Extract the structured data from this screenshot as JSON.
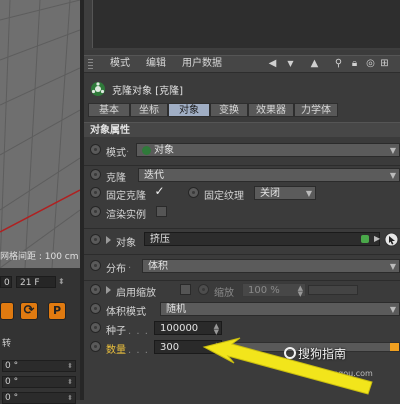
{
  "viewport": {
    "grid_spacing_text": "网格间距 : 100 cm"
  },
  "timeline": {
    "frame_start": "0",
    "frame_end": "21 F"
  },
  "left_panel": {
    "label": "转",
    "fields": [
      "0 °",
      "0 °",
      "0 °"
    ]
  },
  "attr_menu": {
    "items": [
      "模式",
      "编辑",
      "用户数据"
    ]
  },
  "object": {
    "title": "克隆对象 [克隆]"
  },
  "tabs": [
    {
      "label": "基本",
      "active": false
    },
    {
      "label": "坐标",
      "active": false
    },
    {
      "label": "对象",
      "active": true
    },
    {
      "label": "变换",
      "active": false
    },
    {
      "label": "效果器",
      "active": false
    },
    {
      "label": "力学体",
      "active": false
    }
  ],
  "section_title": "对象属性",
  "props": {
    "mode_label": "模式",
    "mode_value": "对象",
    "clone_label": "克隆",
    "clone_value": "迭代",
    "fix_clone_label": "固定克隆",
    "fix_clone_checked": "✓",
    "fix_texture_label": "固定纹理",
    "fix_texture_value": "关闭",
    "render_instance_label": "渲染实例",
    "object_label": "对象",
    "object_value": "挤压",
    "distribution_label": "分布",
    "distribution_value": "体积",
    "enable_scale_label": "启用缩放",
    "scale_label": "缩放",
    "scale_value": "100 %",
    "volume_mode_label": "体积模式",
    "volume_mode_value": "随机",
    "seed_label": "种子",
    "seed_value": "100000",
    "count_label": "数量",
    "count_value": "300",
    "count_slider": 0.05
  },
  "watermark": {
    "brand": "搜狗指南",
    "url": "zhinan.sogou.com"
  },
  "colors": {
    "accent_orange": "#f0a020",
    "tab_active": "#a0aec4",
    "arrow_yellow": "#f2e51b"
  }
}
